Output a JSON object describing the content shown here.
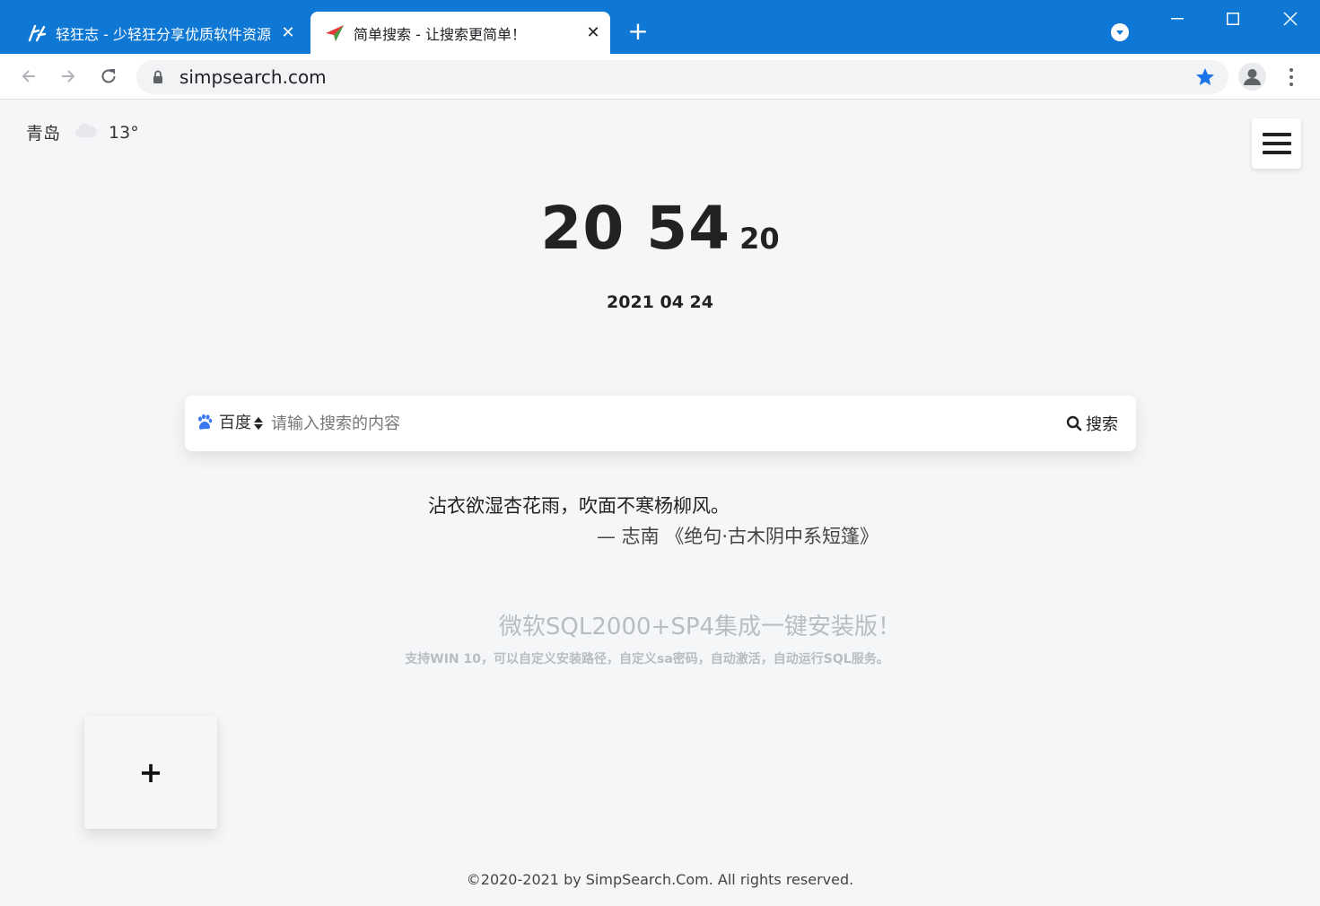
{
  "browser": {
    "tabs": [
      {
        "title": "轻狂志 - 少轻狂分享优质软件资源",
        "close": "✕",
        "favicon": "qkz-logo-icon"
      },
      {
        "title": "简单搜索 - 让搜索更简单！",
        "close": "✕",
        "favicon": "paper-plane-icon"
      }
    ],
    "new_tab": "+",
    "url": "simpsearch.com",
    "accent": "#0f78d4",
    "bookmark_star_color": "#1a73e8"
  },
  "weather": {
    "city": "青岛",
    "icon": "cloud-icon",
    "temp": "13°"
  },
  "clock": {
    "hours_minutes": "20 54",
    "seconds": "20",
    "date": "2021 04 24"
  },
  "search": {
    "engine": "百度",
    "engine_icon": "baidu-paw-icon",
    "placeholder": "请输入搜索的内容",
    "button": "搜索"
  },
  "poem": {
    "line": "沾衣欲湿杏花雨，吹面不寒杨柳风。",
    "source": "— 志南 《绝句·古木阴中系短篷》"
  },
  "ad": {
    "title": "微软SQL2000+SP4集成一键安装版！",
    "subtitle": "支持WIN 10，可以自定义安装路径，自定义sa密码，自动激活，自动运行SQL服务。"
  },
  "add_card": {
    "label": "+"
  },
  "footer": "©2020-2021 by SimpSearch.Com. All rights reserved."
}
